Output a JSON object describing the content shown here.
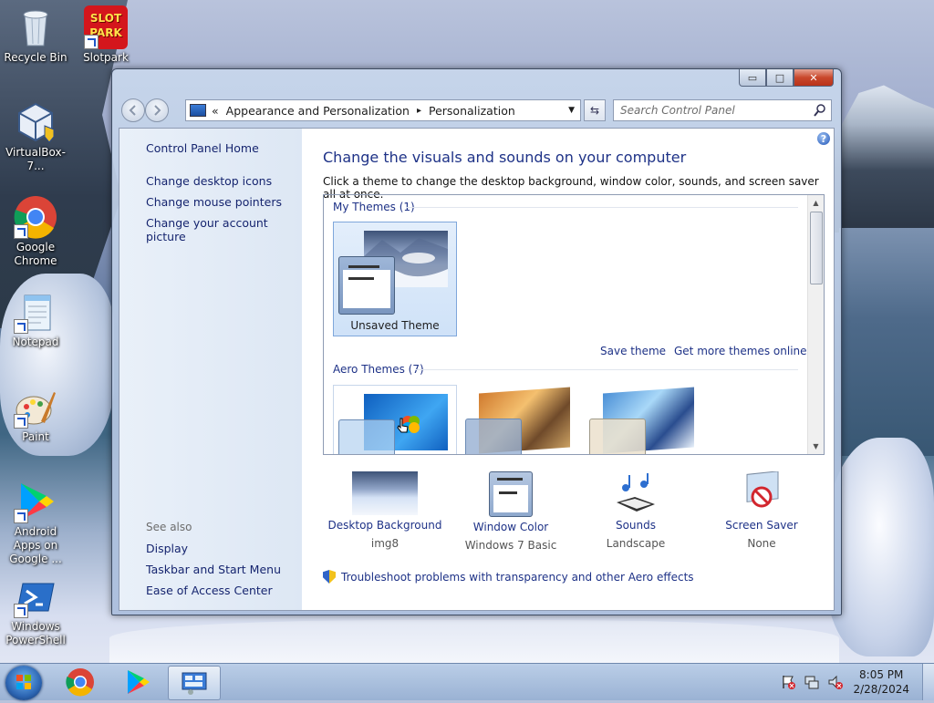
{
  "desktop_icons": [
    {
      "label": "Recycle Bin",
      "icon": "recycle-bin-icon"
    },
    {
      "label": "Slotpark",
      "icon": "slotpark-icon",
      "logo_text": "SLOT PARK"
    },
    {
      "label": "VirtualBox-7...",
      "icon": "virtualbox-icon"
    },
    {
      "label": "Google Chrome",
      "icon": "chrome-icon"
    },
    {
      "label": "Notepad",
      "icon": "notepad-icon"
    },
    {
      "label": "Paint",
      "icon": "paint-icon"
    },
    {
      "label": "Android Apps on Google ...",
      "icon": "google-play-icon"
    },
    {
      "label": "Windows PowerShell",
      "icon": "powershell-icon"
    }
  ],
  "window": {
    "caption_buttons": {
      "minimize": "▭",
      "maximize": "□",
      "close": "✕"
    },
    "breadcrumb": {
      "chevron": "«",
      "parent": "Appearance and Personalization",
      "separator": "▸",
      "current": "Personalization"
    },
    "search_placeholder": "Search Control Panel"
  },
  "left_pane": {
    "home": "Control Panel Home",
    "links": [
      "Change desktop icons",
      "Change mouse pointers",
      "Change your account picture"
    ],
    "see_also_header": "See also",
    "see_also": [
      "Display",
      "Taskbar and Start Menu",
      "Ease of Access Center"
    ]
  },
  "main": {
    "title": "Change the visuals and sounds on your computer",
    "description": "Click a theme to change the desktop background, window color, sounds, and screen saver all at once.",
    "my_themes_header": "My Themes (1)",
    "my_themes": [
      {
        "name": "Unsaved Theme",
        "selected": true
      }
    ],
    "save_theme": "Save theme",
    "get_more": "Get more themes online",
    "aero_themes_header": "Aero Themes (7)",
    "bottom_items": [
      {
        "label": "Desktop Background",
        "value": "img8",
        "icon": "desktop-background-icon"
      },
      {
        "label": "Window Color",
        "value": "Windows 7 Basic",
        "icon": "window-color-icon"
      },
      {
        "label": "Sounds",
        "value": "Landscape",
        "icon": "sounds-icon"
      },
      {
        "label": "Screen Saver",
        "value": "None",
        "icon": "screen-saver-icon"
      }
    ],
    "troubleshoot": "Troubleshoot problems with transparency and other Aero effects"
  },
  "taskbar": {
    "time": "8:05 PM",
    "date": "2/28/2024"
  }
}
